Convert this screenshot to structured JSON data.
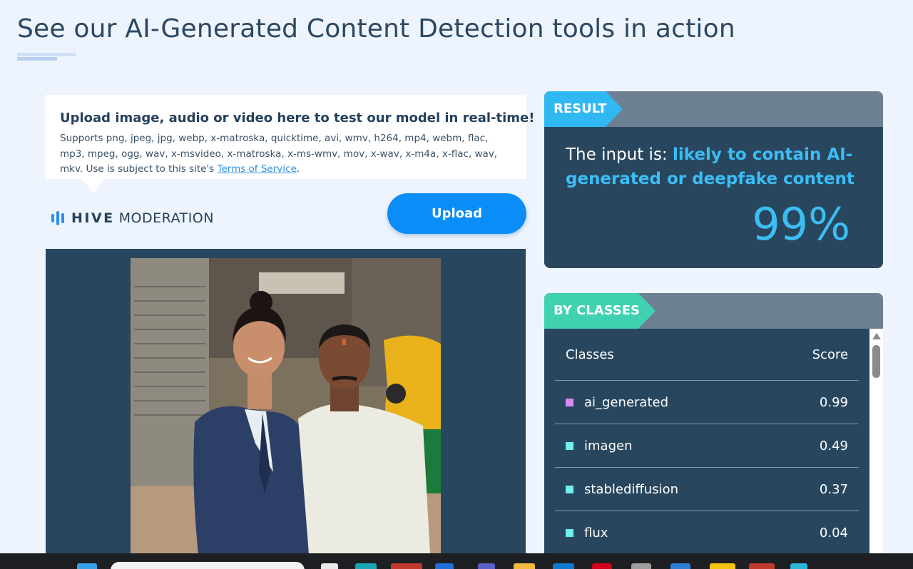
{
  "page": {
    "title": "See our AI-Generated Content Detection tools in action"
  },
  "upload": {
    "heading": "Upload image, audio or video here to test our model in real-time!",
    "description": "Supports png, jpeg, jpg, webp, x-matroska, quicktime, avi, wmv, h264, mp4, webm, flac, mp3, mpeg, ogg, wav, x-msvideo, x-matroska, x-ms-wmv, mov, x-wav, x-m4a, x-flac, wav, mkv. Use is subject to this site's",
    "terms_link": "Terms of Service",
    "terms_suffix": ".",
    "button_label": "Upload"
  },
  "logo": {
    "brand": "HIVE",
    "product": "MODERATION"
  },
  "result": {
    "tag": "RESULT",
    "prefix": "The input is:",
    "verdict": "likely to contain AI-generated or deepfake content",
    "score": "99%",
    "accent_color": "#3cbdf5"
  },
  "classes": {
    "tag": "BY CLASSES",
    "header_class": "Classes",
    "header_score": "Score",
    "rows": [
      {
        "name": "ai_generated",
        "score": "0.99",
        "color": "#d88cf0"
      },
      {
        "name": "imagen",
        "score": "0.49",
        "color": "#6ff0ee"
      },
      {
        "name": "stablediffusion",
        "score": "0.37",
        "color": "#6ff0ee"
      },
      {
        "name": "flux",
        "score": "0.04",
        "color": "#6ff0ee"
      }
    ]
  }
}
